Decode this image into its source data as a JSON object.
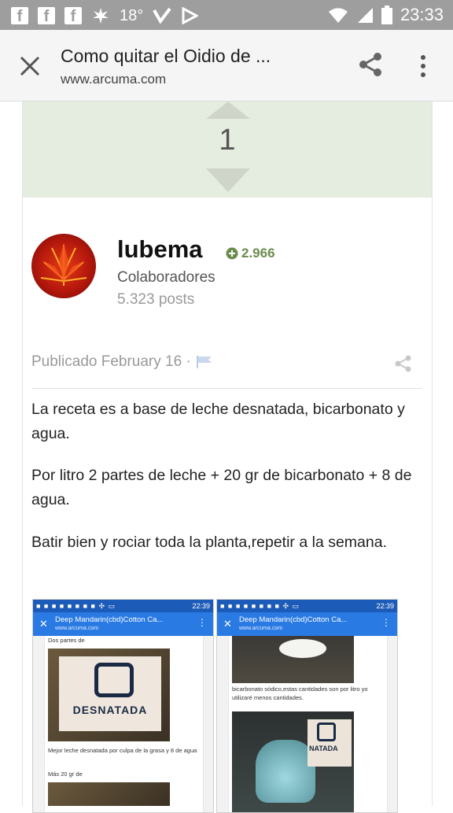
{
  "status_bar": {
    "temperature": "18°",
    "time": "23:33"
  },
  "browser": {
    "title": "Como quitar el Oidio de ...",
    "url": "www.arcuma.com"
  },
  "vote": {
    "count": "1"
  },
  "author": {
    "name": "lubema",
    "reputation": "2.966",
    "group": "Colaboradores",
    "posts": "5.323 posts"
  },
  "post": {
    "published": "Publicado February 16 ·",
    "paragraphs": [
      "La receta es a base de leche desnatada, bicarbonato y agua.",
      "Por litro 2 partes de leche + 20 gr de bicarbonato + 8 de agua.",
      "Batir bien y rociar toda la planta,repetir a la semana."
    ]
  },
  "screenshots": [
    {
      "time": "22:39",
      "title": "Deep Mandarin(cbd)Cotton Ca...",
      "url": "www.arcuma.com",
      "text_1": "Dos partes de",
      "brand": "DESNATADA",
      "text_2": "Mejor leche desnatada por culpa de la grasa y 8 de agua",
      "text_3": "Más 20 gr de"
    },
    {
      "time": "22:39",
      "title": "Deep Mandarin(cbd)Cotton Ca...",
      "url": "www.arcuma.com",
      "text_1": "bicarbonato sódico,estas cantidades son por litro yo utilizaré menos cantidades.",
      "brand": "NATADA"
    }
  ],
  "colors": {
    "vote_bg": "#e5ece0",
    "reputation": "#6b8b4f",
    "status_bar": "#9e9e9e",
    "mobile_bar": "#2a7ae4"
  }
}
